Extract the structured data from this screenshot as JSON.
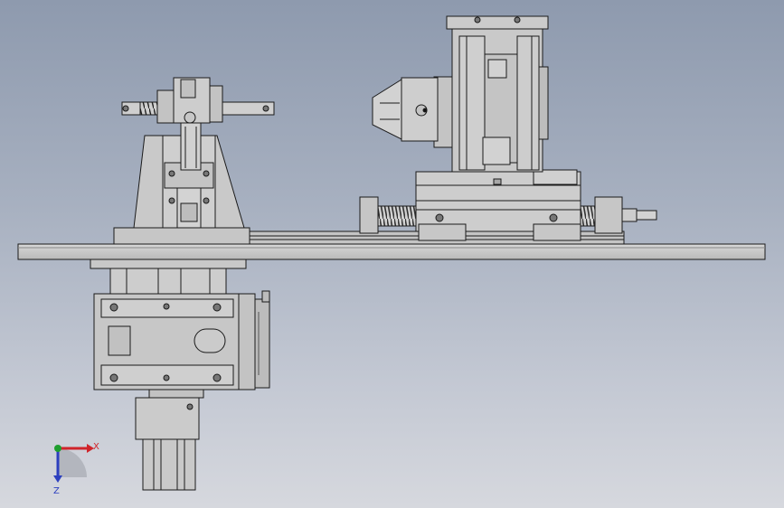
{
  "viewport": {
    "background_top": "#8e9aae",
    "background_bottom": "#d6d8de"
  },
  "model": {
    "part_color": "#c9c9c9",
    "edge_color": "#1a1a1a",
    "shadow_color": "#8f8f8f",
    "assemblies": [
      "base-plate",
      "bottom-gearbox",
      "bottom-motor",
      "left-pedestal",
      "left-crank-handle",
      "right-chuck",
      "right-gearhead",
      "right-slide-table",
      "lead-screw",
      "linear-rail"
    ]
  },
  "triad": {
    "x_label": "X",
    "z_label": "Z",
    "x_color": "#d0242a",
    "z_color": "#2c3fbf",
    "y_color": "#1e9e2e"
  }
}
